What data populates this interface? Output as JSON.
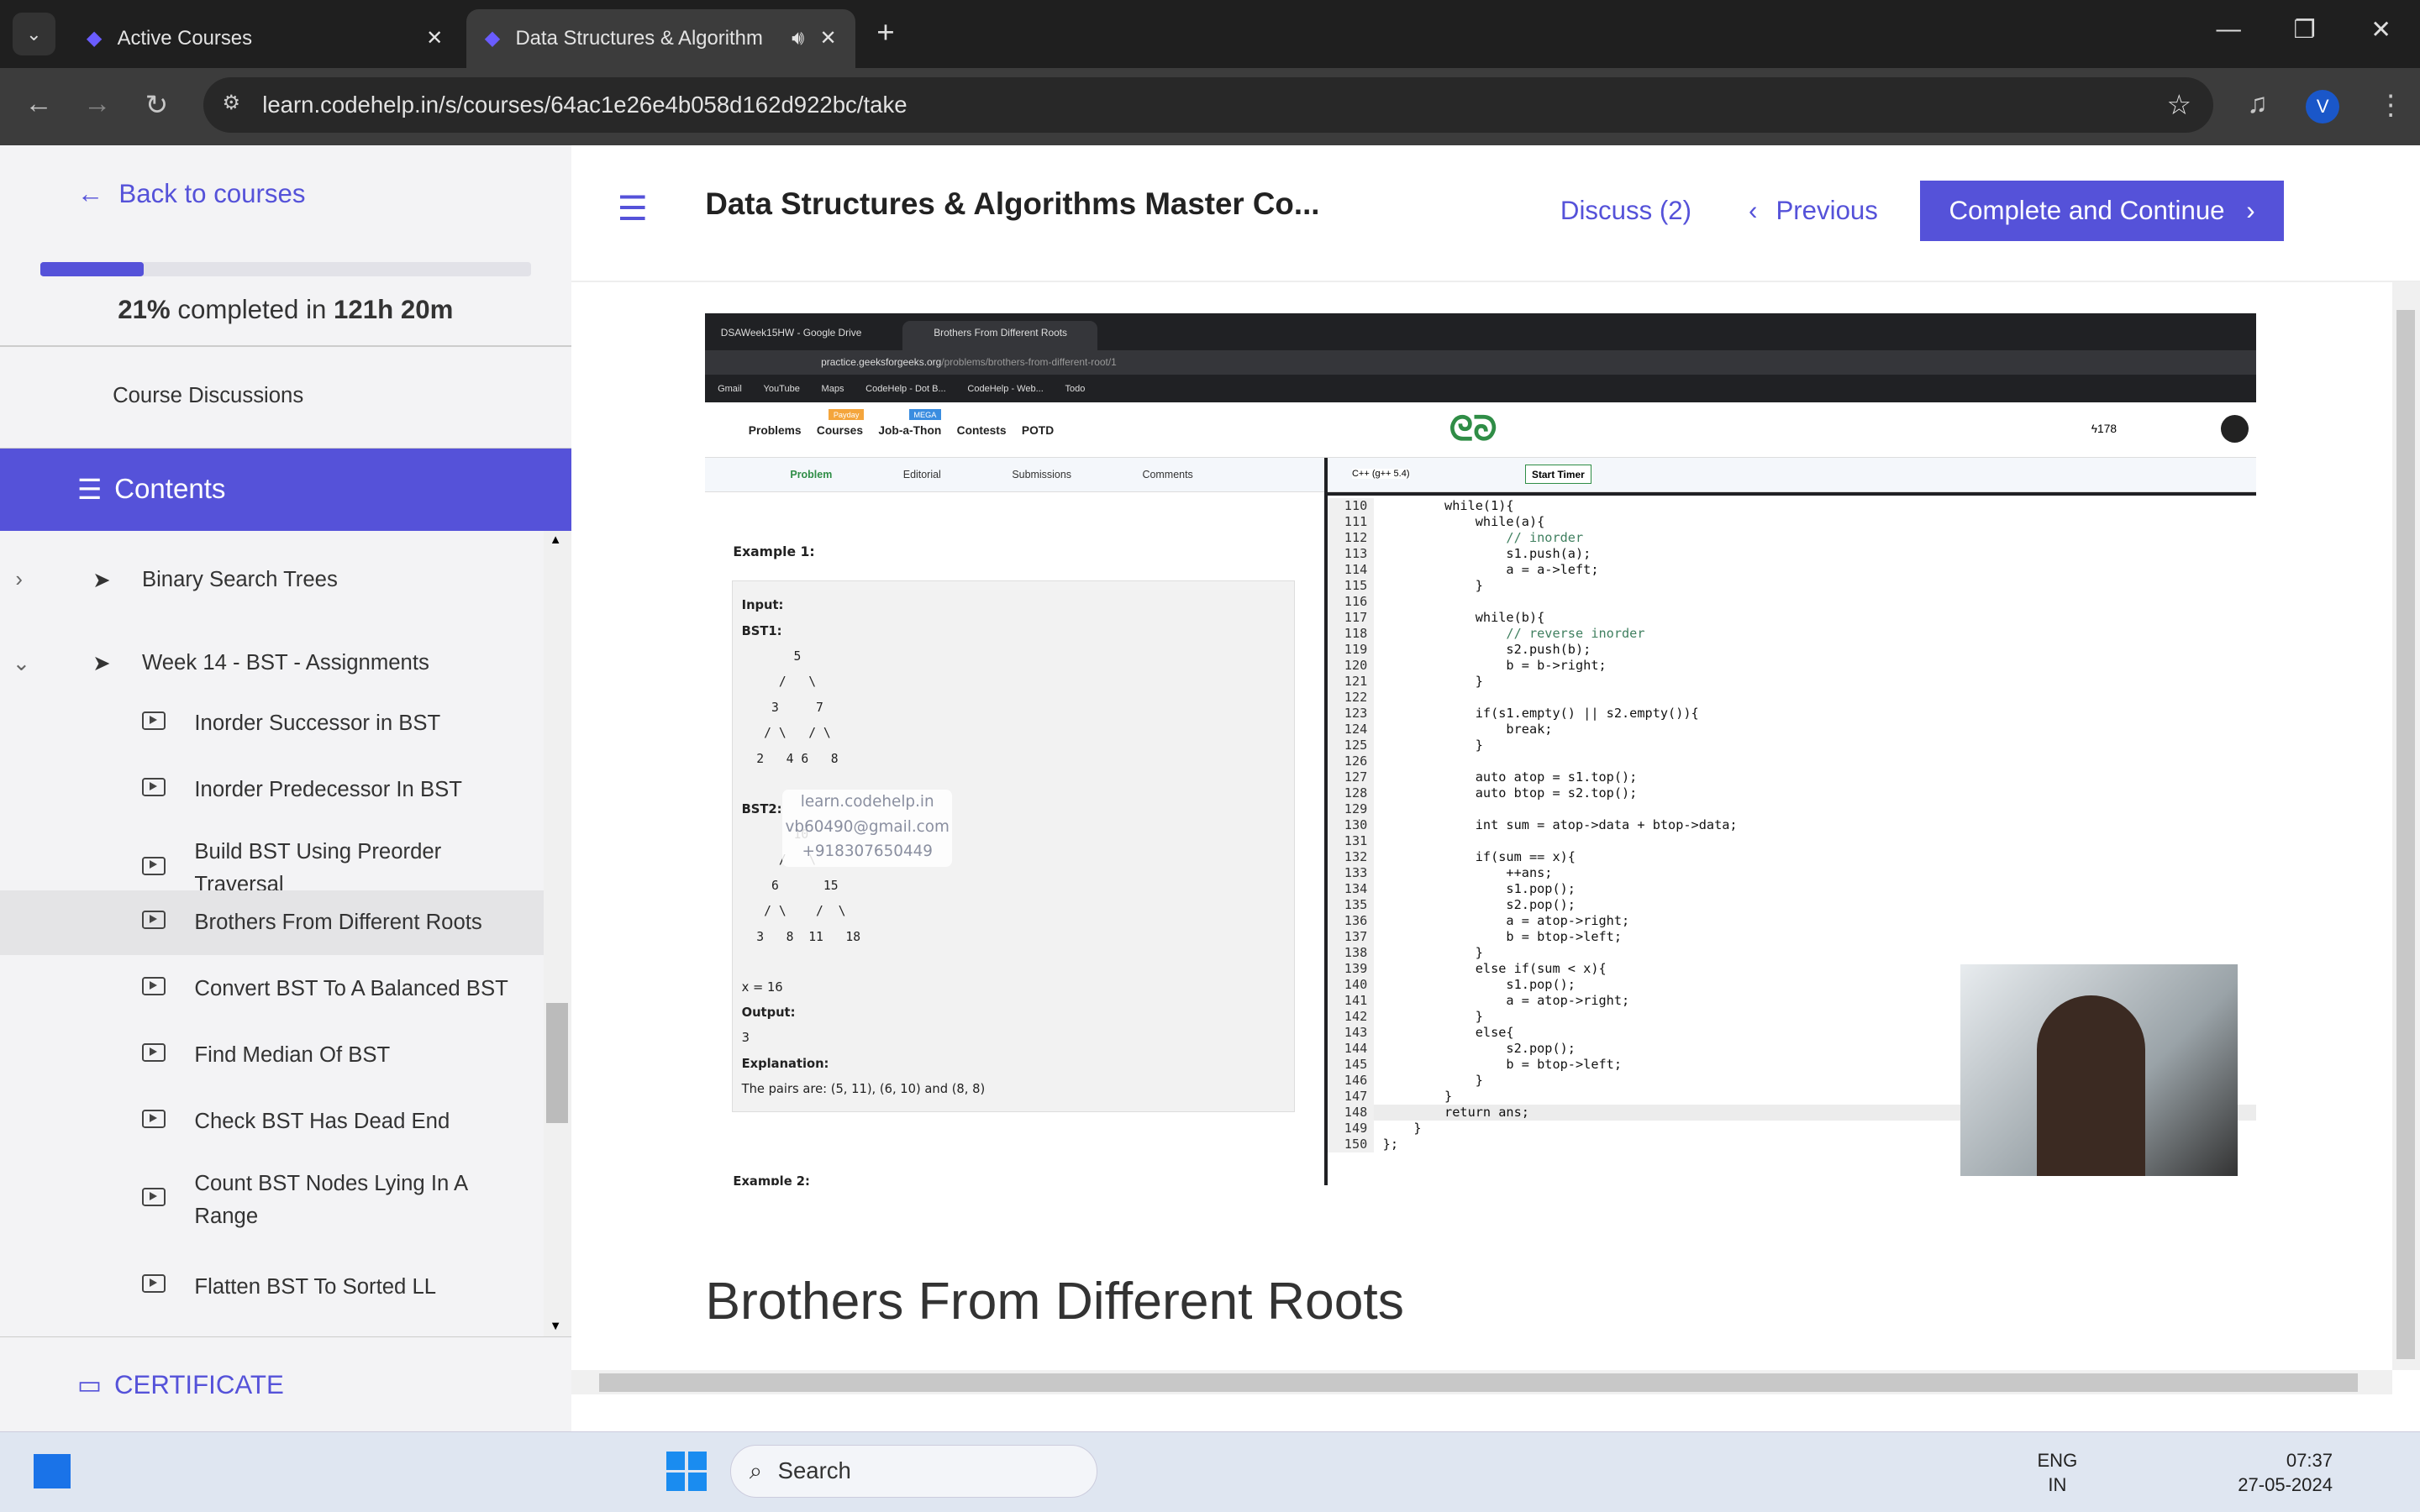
{
  "browser": {
    "tabs": [
      {
        "label": "Active Courses",
        "icon": "codehelp-icon"
      },
      {
        "label": "Data Structures & Algorithm",
        "icon": "codehelp-icon",
        "audio": true
      }
    ],
    "url": "learn.codehelp.in/s/courses/64ac1e26e4b058d162d922bc/take",
    "profile_initial": "V"
  },
  "sidebar": {
    "back_label": "Back to courses",
    "progress_percent": 21,
    "progress_pct_text": "21%",
    "progress_mid": " completed in ",
    "progress_time": "121h 20m",
    "discussions": "Course Discussions",
    "contents": "Contents",
    "sections": [
      {
        "label": "Binary Search Trees",
        "expanded": false
      },
      {
        "label": "Week 14 - BST - Assignments",
        "expanded": true
      }
    ],
    "lessons": [
      "Inorder Successor in BST",
      "Inorder Predecessor In BST",
      "Build BST Using Preorder Traversal",
      "Brothers From Different Roots",
      "Convert BST To A Balanced BST",
      "Find Median Of BST",
      "Check BST Has Dead End",
      "Count BST Nodes Lying In A Range",
      "Flatten BST To Sorted LL"
    ],
    "selected_lesson": "Brothers From Different Roots",
    "certificate": "CERTIFICATE"
  },
  "header": {
    "title": "Data Structures & Algorithms Master Co...",
    "discuss": "Discuss (2)",
    "previous": "Previous",
    "complete": "Complete and Continue"
  },
  "lesson_heading": "Brothers From Different Roots",
  "video": {
    "tabs": [
      "DSAWeek15HW - Google Drive",
      "Brothers From Different Roots"
    ],
    "url_host": "practice.geeksforgeeks.org",
    "url_path": "/problems/brothers-from-different-root/1",
    "bookmarks": [
      "Gmail",
      "YouTube",
      "Maps",
      "CodeHelp - Dot B...",
      "CodeHelp - Web...",
      "Todo"
    ],
    "gfg_nav": [
      "Problems",
      "Courses",
      "Job-a-Thon",
      "Contests",
      "POTD"
    ],
    "badges": {
      "courses": "Payday",
      "jobathon": "MEGA"
    },
    "streak": "178",
    "subtabs": [
      "Problem",
      "Editorial",
      "Submissions",
      "Comments"
    ],
    "language": "C++ (g++ 5.4)",
    "timer": "Start Timer",
    "example_title": "Example 1:",
    "input": "Input:",
    "bst1": "BST1:",
    "bst1_tree": "       5\n     /   \\\n    3     7\n   / \\   / \\\n  2   4 6   8",
    "bst2": "BST2:",
    "bst2_tree": "       10\n     /   \\\n    6      15\n   / \\    /  \\\n  3   8  11   18",
    "x_line": "x = 16",
    "output": "Output:",
    "output_val": "3",
    "explanation": "Explanation:",
    "explanation_text": "The pairs are: (5, 11), (6, 10) and (8, 8)",
    "example2": "Example 2:",
    "watermark": [
      "learn.codehelp.in",
      "vb60490@gmail.com",
      "+918307650449"
    ],
    "code": [
      {
        "n": "110",
        "c": "        while(1){"
      },
      {
        "n": "111",
        "c": "            while(a){"
      },
      {
        "n": "112",
        "c": "                // inorder"
      },
      {
        "n": "113",
        "c": "                s1.push(a);"
      },
      {
        "n": "114",
        "c": "                a = a->left;"
      },
      {
        "n": "115",
        "c": "            }"
      },
      {
        "n": "116",
        "c": ""
      },
      {
        "n": "117",
        "c": "            while(b){"
      },
      {
        "n": "118",
        "c": "                // reverse inorder"
      },
      {
        "n": "119",
        "c": "                s2.push(b);"
      },
      {
        "n": "120",
        "c": "                b = b->right;"
      },
      {
        "n": "121",
        "c": "            }"
      },
      {
        "n": "122",
        "c": ""
      },
      {
        "n": "123",
        "c": "            if(s1.empty() || s2.empty()){"
      },
      {
        "n": "124",
        "c": "                break;"
      },
      {
        "n": "125",
        "c": "            }"
      },
      {
        "n": "126",
        "c": ""
      },
      {
        "n": "127",
        "c": "            auto atop = s1.top();"
      },
      {
        "n": "128",
        "c": "            auto btop = s2.top();"
      },
      {
        "n": "129",
        "c": ""
      },
      {
        "n": "130",
        "c": "            int sum = atop->data + btop->data;"
      },
      {
        "n": "131",
        "c": ""
      },
      {
        "n": "132",
        "c": "            if(sum == x){"
      },
      {
        "n": "133",
        "c": "                ++ans;"
      },
      {
        "n": "134",
        "c": "                s1.pop();"
      },
      {
        "n": "135",
        "c": "                s2.pop();"
      },
      {
        "n": "136",
        "c": "                a = atop->right;"
      },
      {
        "n": "137",
        "c": "                b = btop->left;"
      },
      {
        "n": "138",
        "c": "            }"
      },
      {
        "n": "139",
        "c": "            else if(sum < x){"
      },
      {
        "n": "140",
        "c": "                s1.pop();"
      },
      {
        "n": "141",
        "c": "                a = atop->right;"
      },
      {
        "n": "142",
        "c": "            }"
      },
      {
        "n": "143",
        "c": "            else{"
      },
      {
        "n": "144",
        "c": "                s2.pop();"
      },
      {
        "n": "145",
        "c": "                b = btop->left;"
      },
      {
        "n": "146",
        "c": "            }"
      },
      {
        "n": "147",
        "c": "        }"
      },
      {
        "n": "148",
        "c": "        return ans;"
      },
      {
        "n": "149",
        "c": "    }"
      },
      {
        "n": "150",
        "c": "};"
      }
    ]
  },
  "taskbar": {
    "search": "Search",
    "lang_top": "ENG",
    "lang_bottom": "IN",
    "time": "07:37",
    "date": "27-05-2024"
  },
  "colors": {
    "accent": "#5552d9",
    "gfg_green": "#2f8d46"
  }
}
